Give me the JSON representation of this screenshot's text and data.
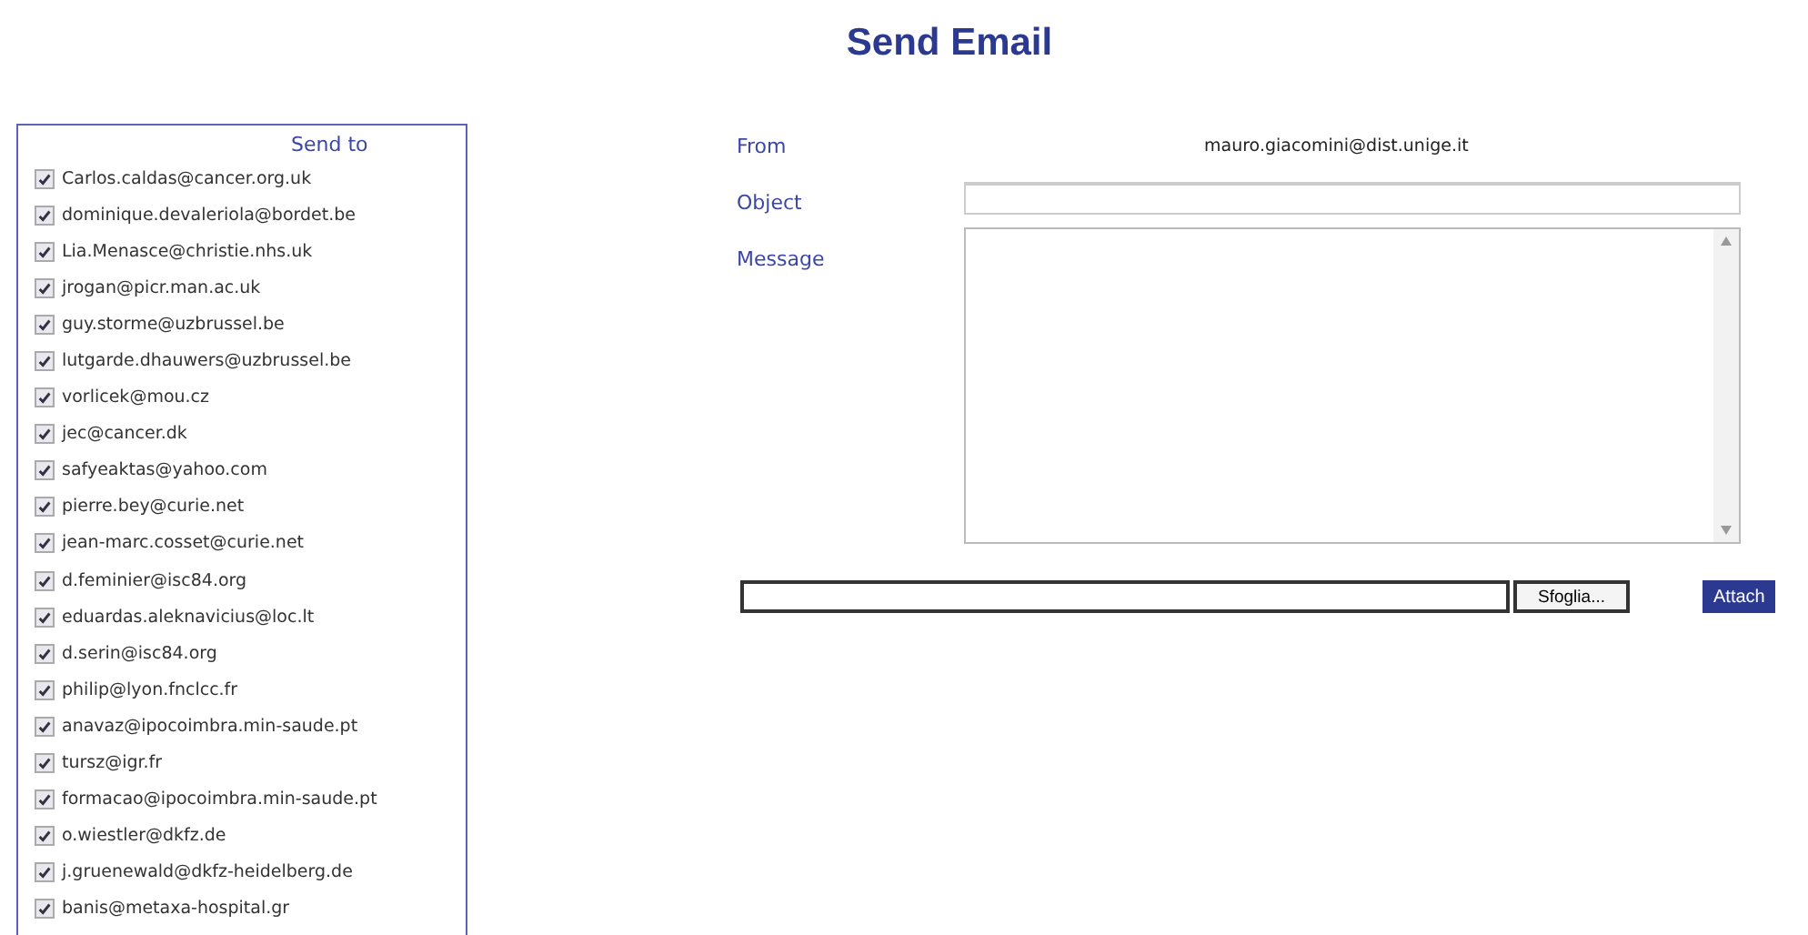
{
  "title": "Send Email",
  "send_to": {
    "heading": "Send to",
    "recipients": [
      {
        "email": "Carlos.caldas@cancer.org.uk",
        "checked": true
      },
      {
        "email": "dominique.devaleriola@bordet.be",
        "checked": true
      },
      {
        "email": "Lia.Menasce@christie.nhs.uk",
        "checked": true
      },
      {
        "email": "jrogan@picr.man.ac.uk",
        "checked": true
      },
      {
        "email": "guy.storme@uzbrussel.be",
        "checked": true
      },
      {
        "email": "lutgarde.dhauwers@uzbrussel.be",
        "checked": true
      },
      {
        "email": "vorlicek@mou.cz",
        "checked": true
      },
      {
        "email": "jec@cancer.dk",
        "checked": true
      },
      {
        "email": "safyeaktas@yahoo.com",
        "checked": true
      },
      {
        "email": "pierre.bey@curie.net",
        "checked": true
      },
      {
        "email": "jean-marc.cosset@curie.net",
        "checked": true
      },
      {
        "email": "d.feminier@isc84.org",
        "checked": true
      },
      {
        "email": "eduardas.aleknavicius@loc.lt",
        "checked": true
      },
      {
        "email": "d.serin@isc84.org",
        "checked": true
      },
      {
        "email": "philip@lyon.fnclcc.fr",
        "checked": true
      },
      {
        "email": "anavaz@ipocoimbra.min-saude.pt",
        "checked": true
      },
      {
        "email": "tursz@igr.fr",
        "checked": true
      },
      {
        "email": "formacao@ipocoimbra.min-saude.pt",
        "checked": true
      },
      {
        "email": "o.wiestler@dkfz.de",
        "checked": true
      },
      {
        "email": "j.gruenewald@dkfz-heidelberg.de",
        "checked": true
      },
      {
        "email": "banis@metaxa-hospital.gr",
        "checked": true
      }
    ]
  },
  "form": {
    "from_label": "From",
    "from_value": "mauro.giacomini@dist.unige.it",
    "object_label": "Object",
    "message_label": "Message",
    "browse_button": "Sfoglia...",
    "attach_button": "Attach"
  }
}
